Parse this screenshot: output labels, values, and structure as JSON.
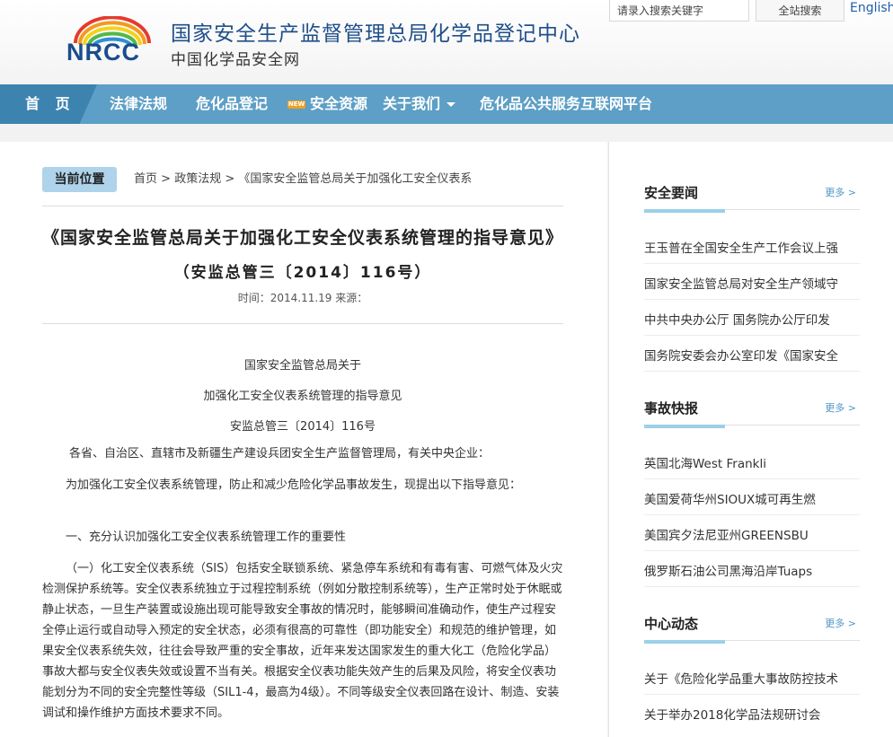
{
  "header": {
    "logo_text": "NRCC",
    "title": "国家安全生产监督管理总局化学品登记中心",
    "subtitle": "中国化学品安全网",
    "search_placeholder": "请录入搜索关键字",
    "search_button": "全站搜索",
    "english_link": "English"
  },
  "nav": {
    "home": "首 页",
    "items": [
      "法律法规",
      "危化品登记",
      "安全资源",
      "关于我们",
      "危化品公共服务互联网平台"
    ],
    "new_badge": "NEW"
  },
  "breadcrumb": {
    "label": "当前位置",
    "home": "首页",
    "section": "政策法规",
    "current": "《国家安全监管总局关于加强化工安全仪表系",
    "separator": ">"
  },
  "article": {
    "title": "《国家安全监管总局关于加强化工安全仪表系统管理的指导意见》",
    "subtitle": "（安监总管三〔2014〕116号）",
    "meta": "时间：2014.11.19   来源：",
    "center_lines": [
      "国家安全监管总局关于",
      "加强化工安全仪表系统管理的指导意见",
      "安监总管三〔2014〕116号"
    ],
    "addressee": "各省、自治区、直辖市及新疆生产建设兵团安全生产监督管理局，有关中央企业：",
    "intro": "为加强化工安全仪表系统管理，防止和减少危险化学品事故发生，现提出以下指导意见：",
    "section_1": "一、充分认识加强化工安全仪表系统管理工作的重要性",
    "para_1": "（一）化工安全仪表系统（SIS）包括安全联锁系统、紧急停车系统和有毒有害、可燃气体及火灾检测保护系统等。安全仪表系统独立于过程控制系统（例如分散控制系统等），生产正常时处于休眠或静止状态，一旦生产装置或设施出现可能导致安全事故的情况时，能够瞬间准确动作，使生产过程安全停止运行或自动导入预定的安全状态，必须有很高的可靠性（即功能安全）和规范的维护管理，如果安全仪表系统失效，往往会导致严重的安全事故，近年来发达国家发生的重大化工（危险化学品）事故大都与安全仪表失效或设置不当有关。根据安全仪表功能失效产生的后果及风险，将安全仪表功能划分为不同的安全完整性等级（SIL1-4，最高为4级）。不同等级安全仪表回路在设计、制造、安装调试和操作维护方面技术要求不同。"
  },
  "sidebar": {
    "more_label": "更多 >",
    "sections": [
      {
        "title": "安全要闻",
        "items": [
          "王玉普在全国安全生产工作会议上强",
          "国家安全监管总局对安全生产领域守",
          "中共中央办公厅 国务院办公厅印发",
          "国务院安委会办公室印发《国家安全"
        ]
      },
      {
        "title": "事故快报",
        "items": [
          "英国北海West Frankli",
          "美国爱荷华州SIOUX城可再生燃",
          "美国宾夕法尼亚州GREENSBU",
          "俄罗斯石油公司黑海沿岸Tuaps"
        ]
      },
      {
        "title": "中心动态",
        "items": [
          "关于《危险化学品重大事故防控技术",
          "关于举办2018化学品法规研讨会"
        ]
      }
    ]
  }
}
